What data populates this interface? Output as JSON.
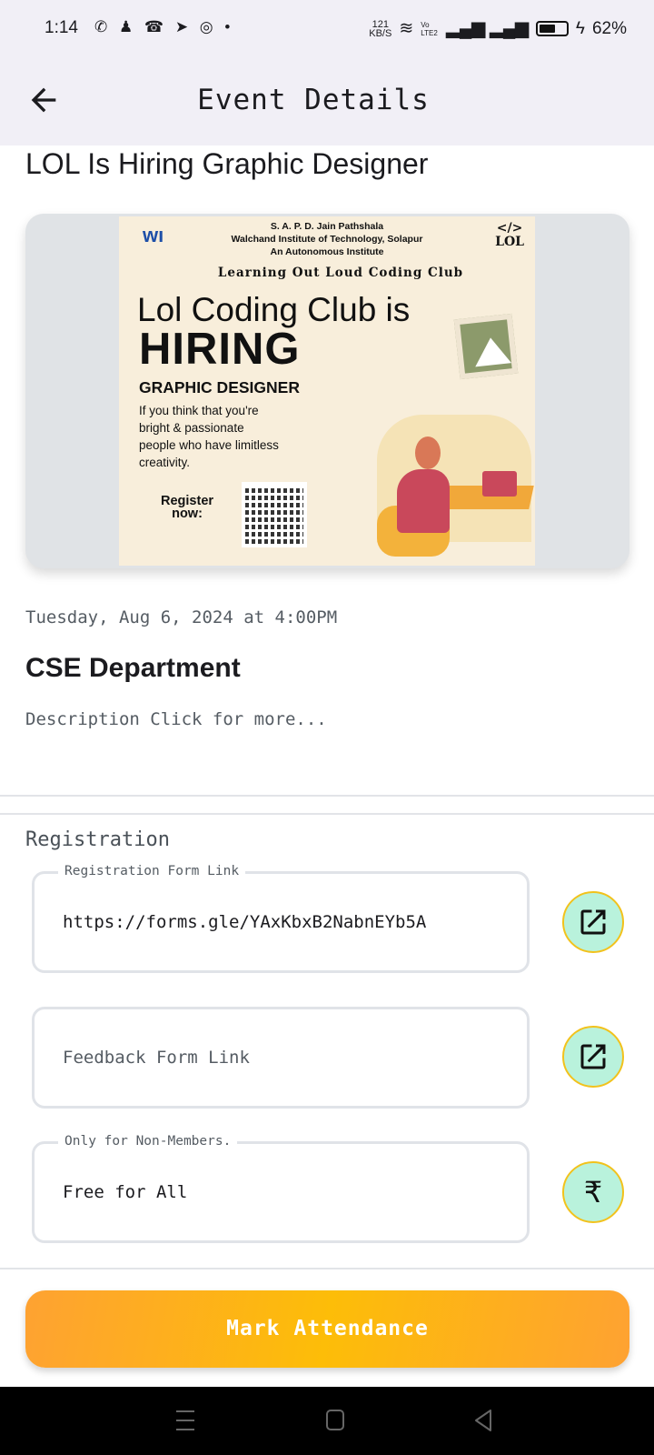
{
  "status_bar": {
    "time": "1:14",
    "app_icons": [
      "whatsapp-icon",
      "snapchat-icon",
      "missed-call-icon",
      "telegram-icon",
      "instagram-icon",
      "dot-icon"
    ],
    "speed": "121",
    "speed_unit": "KB/S",
    "volte": "Vo LTE2",
    "battery": "62%",
    "battery_fraction": 0.62
  },
  "header": {
    "title": "Event Details",
    "back_icon": "arrow-left-icon"
  },
  "event": {
    "title": "LOL Is Hiring Graphic Designer",
    "poster": {
      "institute": [
        "S. A. P. D. Jain Pathshala",
        "Walchand Institute of Technology, Solapur",
        "An Autonomous Institute"
      ],
      "logo_left": "wit",
      "logo_right": "LOL",
      "club": "Learning Out Loud Coding Club",
      "headline": "Lol Coding Club is",
      "hiring": "HIRING",
      "role": "GRAPHIC DESIGNER",
      "text": [
        "If you think that you're",
        "bright & passionate",
        "people who have limitless",
        "creativity."
      ],
      "register": [
        "Register",
        "now:"
      ]
    },
    "datetime": "Tuesday, Aug 6, 2024 at 4:00PM",
    "department": "CSE Department",
    "description": "Description Click for more..."
  },
  "registration": {
    "heading": "Registration",
    "fields": [
      {
        "label": "Registration Form Link",
        "value": "https://forms.gle/YAxKbxB2NabnEYb5A",
        "icon": "open-in-new-icon"
      },
      {
        "label": "",
        "placeholder": "Feedback Form Link",
        "icon": "open-in-new-icon"
      },
      {
        "label": "Only for Non-Members.",
        "value": "Free for All",
        "icon": "rupee-icon",
        "icon_glyph": "₹"
      }
    ]
  },
  "actions": {
    "mark_attendance": "Mark Attendance"
  },
  "colors": {
    "header_bg": "#f1eff6",
    "button_from": "#fea232",
    "button_mid": "#fdbd08",
    "icon_btn_bg": "#b9f2dc",
    "icon_btn_border": "#f2c21c"
  }
}
